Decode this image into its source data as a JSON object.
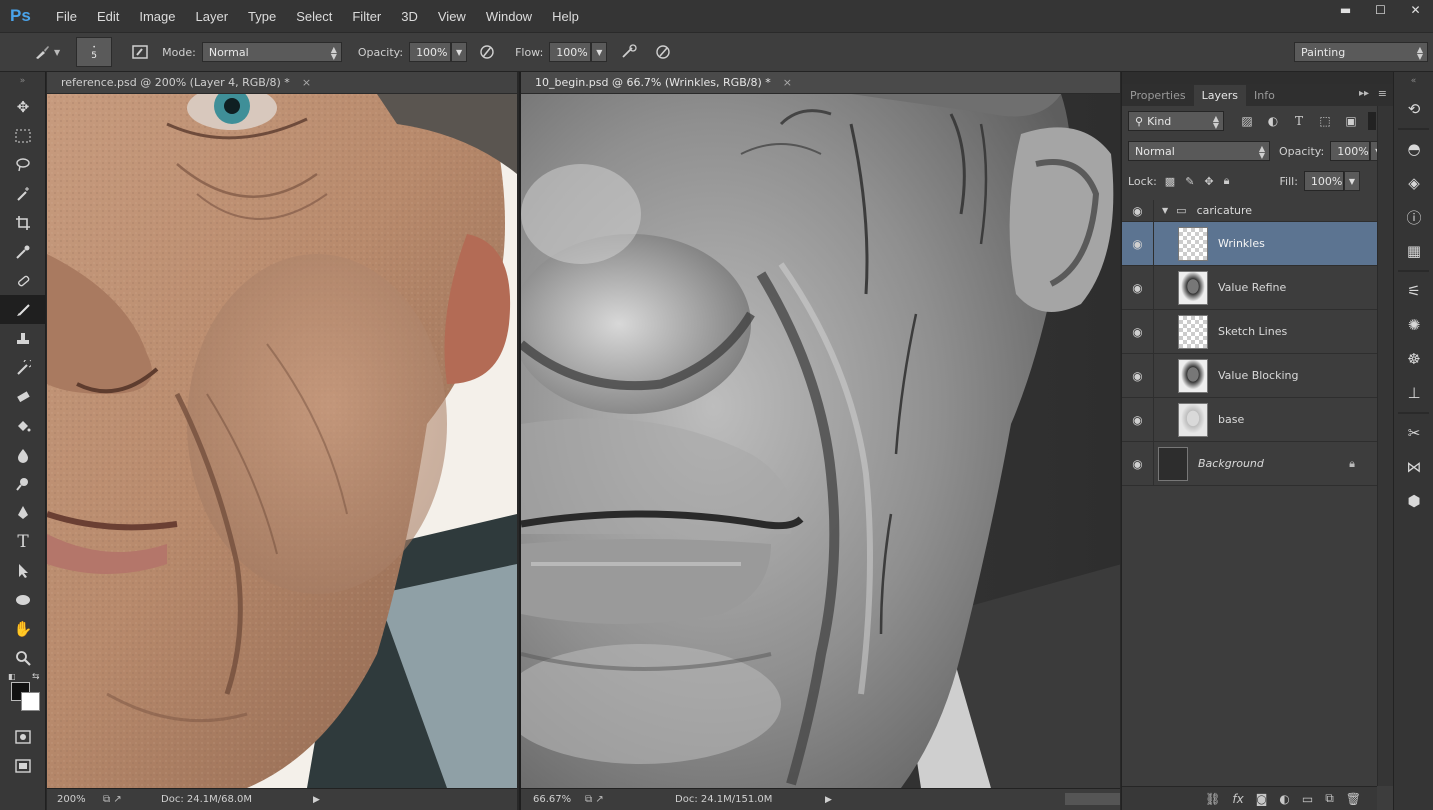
{
  "app": {
    "logo": "Ps"
  },
  "menu": [
    "File",
    "Edit",
    "Image",
    "Layer",
    "Type",
    "Select",
    "Filter",
    "3D",
    "View",
    "Window",
    "Help"
  ],
  "window_controls": {
    "minimize": "▬",
    "maximize": "☐",
    "close": "✕"
  },
  "options_bar": {
    "brush_size": "5",
    "mode_label": "Mode:",
    "mode_value": "Normal",
    "opacity_label": "Opacity:",
    "opacity_value": "100%",
    "flow_label": "Flow:",
    "flow_value": "100%",
    "workspace": "Painting"
  },
  "docs": {
    "left": {
      "tab_title": "reference.psd @ 200% (Layer 4, RGB/8) *",
      "close": "×",
      "zoom": "200%",
      "doc_info": "Doc: 24.1M/68.0M"
    },
    "right": {
      "tab_title": "10_begin.psd @ 66.7% (Wrinkles, RGB/8) *",
      "close": "×",
      "zoom": "66.67%",
      "doc_info": "Doc: 24.1M/151.0M"
    }
  },
  "layers_panel": {
    "tabs": [
      "Properties",
      "Layers",
      "Info"
    ],
    "active_tab": "Layers",
    "filter_kind": "Kind",
    "blend_mode": "Normal",
    "opacity_label": "Opacity:",
    "opacity_value": "100%",
    "lock_label": "Lock:",
    "fill_label": "Fill:",
    "fill_value": "100%",
    "group_name": "caricature",
    "layers": [
      {
        "name": "Wrinkles",
        "selected": true
      },
      {
        "name": "Value Refine",
        "selected": false
      },
      {
        "name": "Sketch Lines",
        "selected": false
      },
      {
        "name": "Value Blocking",
        "selected": false
      },
      {
        "name": "base",
        "selected": false
      },
      {
        "name": "Background",
        "selected": false
      }
    ]
  },
  "colors": {
    "selection": "#5c7491",
    "ps_blue": "#4aa3ea"
  }
}
